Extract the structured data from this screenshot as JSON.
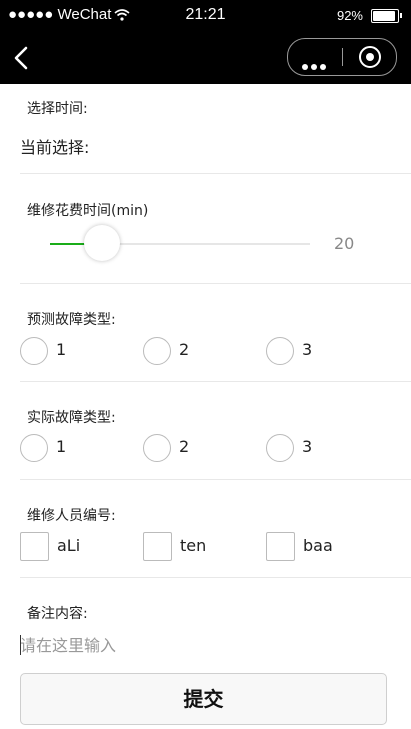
{
  "status_bar": {
    "carrier": "●●●●● WeChat",
    "wifi": "wifi-icon",
    "time": "21:21",
    "battery_pct": "92%",
    "battery_level": 0.92
  },
  "nav": {
    "back_icon": "back-chevron-icon",
    "more_icon": "more-dots-icon",
    "close_icon": "target-circle-icon"
  },
  "form": {
    "time_section": {
      "label": "选择时间:",
      "current": "当前选择:"
    },
    "duration": {
      "label": "维修花费时间(min)",
      "value": "20",
      "slider_fraction": 0.15,
      "accent": "#1aad19"
    },
    "predicted_fault": {
      "label": "预测故障类型:",
      "options": [
        "1",
        "2",
        "3"
      ]
    },
    "actual_fault": {
      "label": "实际故障类型:",
      "options": [
        "1",
        "2",
        "3"
      ]
    },
    "staff": {
      "label": "维修人员编号:",
      "options": [
        "aLi",
        "ten",
        "baa"
      ]
    },
    "remark": {
      "label": "备注内容:",
      "placeholder": "请在这里输入",
      "value": ""
    },
    "submit_label": "提交"
  }
}
